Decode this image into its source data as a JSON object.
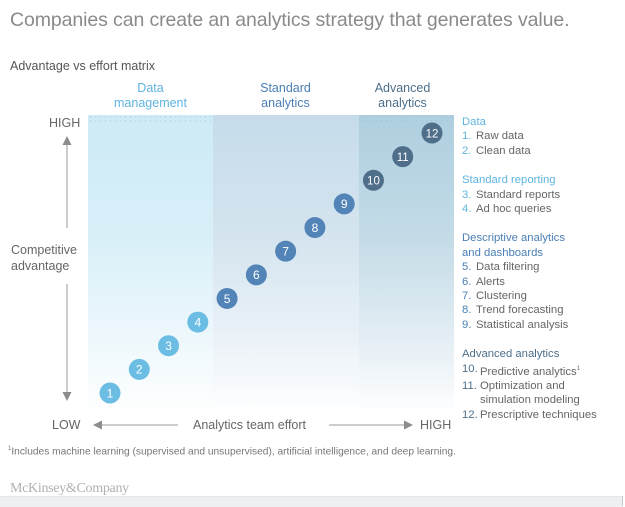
{
  "title": "Companies can create an analytics strategy that generates value.",
  "subtitle": "Advantage vs effort matrix",
  "columns": [
    {
      "line1": "Data",
      "line2": "management",
      "color": "#5fb4e0"
    },
    {
      "line1": "Standard",
      "line2": "analytics",
      "color": "#4a7fb5"
    },
    {
      "line1": "Advanced",
      "line2": "analytics",
      "color": "#4d6f8a"
    }
  ],
  "y_axis": {
    "high": "HIGH",
    "low": "LOW",
    "label_line1": "Competitive",
    "label_line2": "advantage"
  },
  "x_axis": {
    "low": "LOW",
    "high": "HIGH",
    "label": "Analytics team effort"
  },
  "chart_data": {
    "type": "scatter",
    "title": "Advantage vs effort matrix",
    "xlabel": "Analytics team effort",
    "ylabel": "Competitive advantage",
    "x_ticks": [
      "LOW",
      "HIGH"
    ],
    "y_ticks": [
      "LOW",
      "HIGH"
    ],
    "regions": [
      "Data management",
      "Standard analytics",
      "Advanced analytics"
    ],
    "points": [
      {
        "id": 1,
        "label": "1",
        "x": 1,
        "y": 1,
        "group": 0
      },
      {
        "id": 2,
        "label": "2",
        "x": 2,
        "y": 2,
        "group": 0
      },
      {
        "id": 3,
        "label": "3",
        "x": 3,
        "y": 3,
        "group": 0
      },
      {
        "id": 4,
        "label": "4",
        "x": 4,
        "y": 4,
        "group": 0
      },
      {
        "id": 5,
        "label": "5",
        "x": 5,
        "y": 5,
        "group": 1
      },
      {
        "id": 6,
        "label": "6",
        "x": 6,
        "y": 6,
        "group": 1
      },
      {
        "id": 7,
        "label": "7",
        "x": 7,
        "y": 7,
        "group": 1
      },
      {
        "id": 8,
        "label": "8",
        "x": 8,
        "y": 8,
        "group": 1
      },
      {
        "id": 9,
        "label": "9",
        "x": 9,
        "y": 9,
        "group": 1
      },
      {
        "id": 10,
        "label": "10",
        "x": 10,
        "y": 10,
        "group": 2
      },
      {
        "id": 11,
        "label": "11",
        "x": 11,
        "y": 11,
        "group": 2
      },
      {
        "id": 12,
        "label": "12",
        "x": 12,
        "y": 12,
        "group": 2
      }
    ],
    "group_colors": [
      "#6cbde3",
      "#5384b8",
      "#4e6e8a"
    ]
  },
  "legend": [
    {
      "heading": [
        "Data"
      ],
      "color": "#5fb4e0",
      "items": [
        {
          "num": "1.",
          "text": [
            "Raw data"
          ]
        },
        {
          "num": "2.",
          "text": [
            "Clean data"
          ]
        }
      ]
    },
    {
      "heading": [
        "Standard reporting"
      ],
      "color": "#5fb4e0",
      "items": [
        {
          "num": "3.",
          "text": [
            "Standard reports"
          ]
        },
        {
          "num": "4.",
          "text": [
            "Ad hoc queries"
          ]
        }
      ]
    },
    {
      "heading": [
        "Descriptive analytics",
        "and dashboards"
      ],
      "color": "#4a7fb5",
      "items": [
        {
          "num": "5.",
          "text": [
            "Data filtering"
          ]
        },
        {
          "num": "6.",
          "text": [
            "Alerts"
          ]
        },
        {
          "num": "7.",
          "text": [
            "Clustering"
          ]
        },
        {
          "num": "8.",
          "text": [
            "Trend forecasting"
          ]
        },
        {
          "num": "9.",
          "text": [
            "Statistical analysis"
          ]
        }
      ]
    },
    {
      "heading": [
        "Advanced analytics"
      ],
      "color": "#4d6f8a",
      "items": [
        {
          "num": "10.",
          "text": [
            "Predictive analytics"
          ],
          "sup": "1"
        },
        {
          "num": "11.",
          "text": [
            "Optimization and",
            "simulation modeling"
          ]
        },
        {
          "num": "12.",
          "text": [
            "Prescriptive techniques"
          ]
        }
      ]
    }
  ],
  "footnote": {
    "marker": "1",
    "text": "Includes machine learning (supervised and unsupervised), artificial intelligence, and deep learning."
  },
  "brand": "McKinsey&Company"
}
